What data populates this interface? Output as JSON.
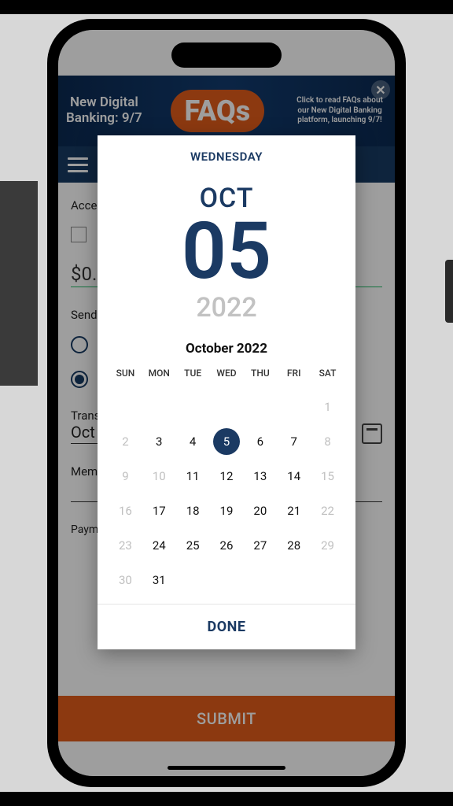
{
  "banner": {
    "left_line1": "New Digital",
    "left_line2": "Banking: 9/7",
    "pill": "FAQs",
    "right": "Click to read FAQs about our New Digital Banking platform, launching 9/7!"
  },
  "form": {
    "accept_label": "Accept",
    "amount": "$0.",
    "send_label": "Send",
    "trans_label": "Trans",
    "date_value": "Oct",
    "memo_label": "Memo",
    "note": "Payments scheduled for today will be applied",
    "submit": "SUBMIT"
  },
  "datepicker": {
    "selected_dow": "WEDNESDAY",
    "selected_month_abbr": "OCT",
    "selected_day": "05",
    "selected_year": "2022",
    "month_title": "October 2022",
    "dow": [
      "SUN",
      "MON",
      "TUE",
      "WED",
      "THU",
      "FRI",
      "SAT"
    ],
    "weeks": [
      [
        {
          "n": "",
          "dim": true
        },
        {
          "n": "",
          "dim": true
        },
        {
          "n": "",
          "dim": true
        },
        {
          "n": "",
          "dim": true
        },
        {
          "n": "",
          "dim": true
        },
        {
          "n": "",
          "dim": true
        },
        {
          "n": "1",
          "dim": true
        }
      ],
      [
        {
          "n": "2",
          "dim": true
        },
        {
          "n": "3"
        },
        {
          "n": "4"
        },
        {
          "n": "5",
          "sel": true
        },
        {
          "n": "6"
        },
        {
          "n": "7"
        },
        {
          "n": "8",
          "dim": true
        }
      ],
      [
        {
          "n": "9",
          "dim": true
        },
        {
          "n": "10",
          "dim": true
        },
        {
          "n": "11"
        },
        {
          "n": "12"
        },
        {
          "n": "13"
        },
        {
          "n": "14"
        },
        {
          "n": "15",
          "dim": true
        }
      ],
      [
        {
          "n": "16",
          "dim": true
        },
        {
          "n": "17"
        },
        {
          "n": "18"
        },
        {
          "n": "19"
        },
        {
          "n": "20"
        },
        {
          "n": "21"
        },
        {
          "n": "22",
          "dim": true
        }
      ],
      [
        {
          "n": "23",
          "dim": true
        },
        {
          "n": "24"
        },
        {
          "n": "25"
        },
        {
          "n": "26"
        },
        {
          "n": "27"
        },
        {
          "n": "28"
        },
        {
          "n": "29",
          "dim": true
        }
      ],
      [
        {
          "n": "30",
          "dim": true
        },
        {
          "n": "31"
        },
        {
          "n": ""
        },
        {
          "n": ""
        },
        {
          "n": ""
        },
        {
          "n": ""
        },
        {
          "n": ""
        }
      ]
    ],
    "done": "DONE"
  }
}
